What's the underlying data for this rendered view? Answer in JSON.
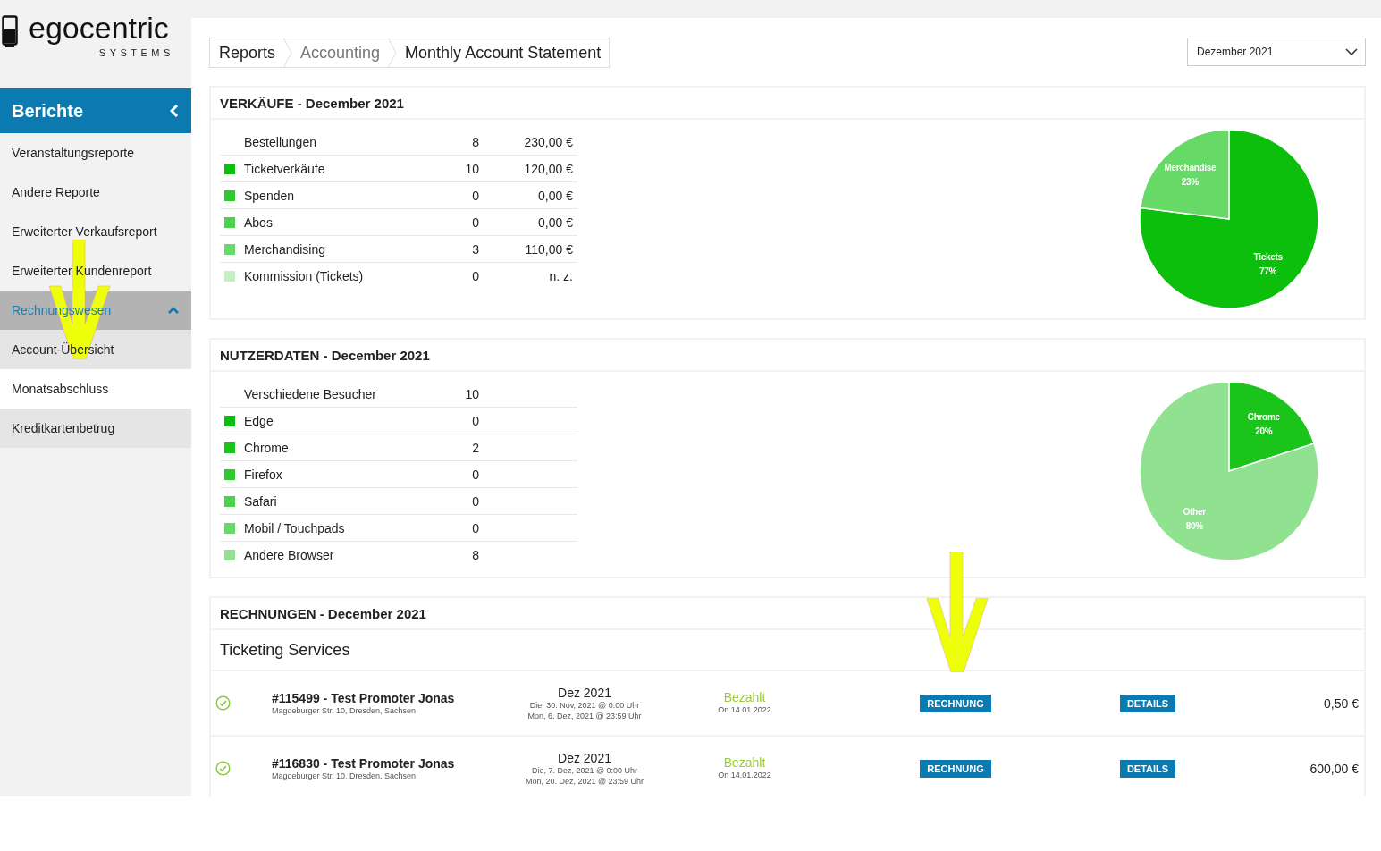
{
  "logo": {
    "name": "egocentric",
    "tagline": "SYSTEMS"
  },
  "sidebar": {
    "title": "Berichte",
    "items": [
      {
        "label": "Veranstaltungsreporte",
        "selected": false
      },
      {
        "label": "Andere Reporte",
        "selected": false
      },
      {
        "label": "Erweiterter Verkaufsreport",
        "selected": false
      },
      {
        "label": "Erweiterter Kundenreport",
        "selected": false
      },
      {
        "label": "Rechnungswesen",
        "selected": false,
        "expanded": true,
        "children": [
          {
            "label": "Account-Übersicht",
            "selected": false
          },
          {
            "label": "Monatsabschluss",
            "selected": true
          },
          {
            "label": "Kreditkartenbetrug",
            "selected": false
          }
        ]
      }
    ]
  },
  "breadcrumb": [
    {
      "label": "Reports",
      "kind": "link"
    },
    {
      "label": "Accounting",
      "kind": "muted"
    },
    {
      "label": "Monthly Account Statement",
      "kind": "current"
    }
  ],
  "month_select": {
    "value": "Dezember 2021"
  },
  "sales": {
    "title": "VERKÄUFE - December 2021",
    "rows": [
      {
        "label": "Bestellungen",
        "count": "8",
        "amount": "230,00 €"
      },
      {
        "label": "Ticketverkäufe",
        "count": "10",
        "amount": "120,00 €",
        "color": "#0cbf0c"
      },
      {
        "label": "Spenden",
        "count": "0",
        "amount": "0,00 €",
        "color": "#2ccb2c"
      },
      {
        "label": "Abos",
        "count": "0",
        "amount": "0,00 €",
        "color": "#4bd14b"
      },
      {
        "label": "Merchandising",
        "count": "3",
        "amount": "110,00 €",
        "color": "#66d966"
      },
      {
        "label": "Kommission (Tickets)",
        "count": "0",
        "amount": "n. z.",
        "color": "#c5efc5"
      }
    ],
    "chart_data": {
      "type": "pie",
      "categories": [
        "Tickets",
        "Merchandise"
      ],
      "values": [
        77,
        23
      ],
      "data_labels": true,
      "value_labels": [
        "77%",
        "23%"
      ]
    }
  },
  "users": {
    "title": "NUTZERDATEN - December 2021",
    "rows": [
      {
        "label": "Verschiedene Besucher",
        "count": "10"
      },
      {
        "label": "Edge",
        "count": "0",
        "color": "#0cbf0c"
      },
      {
        "label": "Chrome",
        "count": "2",
        "color": "#1ac41a"
      },
      {
        "label": "Firefox",
        "count": "0",
        "color": "#2ccb2c"
      },
      {
        "label": "Safari",
        "count": "0",
        "color": "#4bd14b"
      },
      {
        "label": "Mobil / Touchpads",
        "count": "0",
        "color": "#66d966"
      },
      {
        "label": "Andere Browser",
        "count": "8",
        "color": "#90e290"
      }
    ],
    "chart_data": {
      "type": "pie",
      "categories": [
        "Chrome",
        "Other"
      ],
      "values": [
        20,
        80
      ],
      "data_labels": true,
      "value_labels": [
        "20%",
        "80%"
      ]
    }
  },
  "invoices": {
    "title": "RECHNUNGEN - December 2021",
    "group": "Ticketing Services",
    "rows": [
      {
        "paid": true,
        "title": "#115499 - Test Promoter Jonas",
        "address": "Magdeburger Str. 10, Dresden, Sachsen",
        "period": "Dez 2021",
        "from": "Die, 30. Nov, 2021 @ 0:00 Uhr",
        "to": "Mon, 6. Dez, 2021 @ 23:59 Uhr",
        "status": "Bezahlt",
        "status_date": "On 14.01.2022",
        "invoice_button": "RECHNUNG",
        "details_button": "DETAILS",
        "amount": "0,50 €"
      },
      {
        "paid": true,
        "title": "#116830 - Test Promoter Jonas",
        "address": "Magdeburger Str. 10, Dresden, Sachsen",
        "period": "Dez 2021",
        "from": "Die, 7. Dez, 2021 @ 0:00 Uhr",
        "to": "Mon, 20. Dez, 2021 @ 23:59 Uhr",
        "status": "Bezahlt",
        "status_date": "On 14.01.2022",
        "invoice_button": "RECHNUNG",
        "details_button": "DETAILS",
        "amount": "600,00 €"
      }
    ]
  }
}
